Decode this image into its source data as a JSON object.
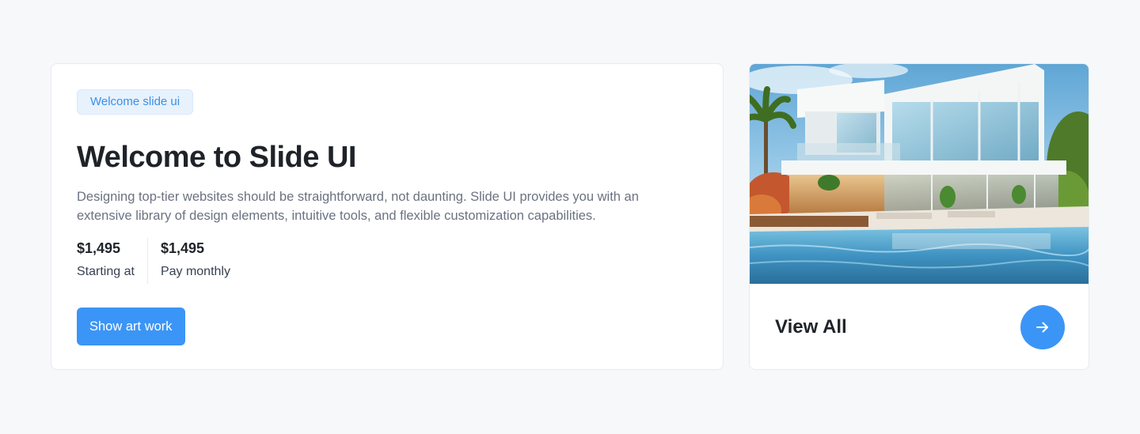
{
  "hero": {
    "badge": "Welcome slide ui",
    "title": "Welcome to Slide UI",
    "description": "Designing top-tier websites should be straightforward, not daunting. Slide UI provides you with an extensive library of design elements, intuitive tools, and flexible customization capabilities.",
    "stats": [
      {
        "price": "$1,495",
        "label": "Starting at"
      },
      {
        "price": "$1,495",
        "label": "Pay monthly"
      }
    ],
    "cta_label": "Show art work"
  },
  "gallery": {
    "image_icon": "modern-villa-photo",
    "view_all_label": "View All",
    "arrow_icon": "arrow-right-icon"
  },
  "colors": {
    "accent": "#3b95f6",
    "badge_bg": "#e7f2fd",
    "badge_text": "#3b8fe8",
    "title": "#1f2329",
    "body_text": "#6b7280",
    "page_bg": "#f7f8fa"
  }
}
